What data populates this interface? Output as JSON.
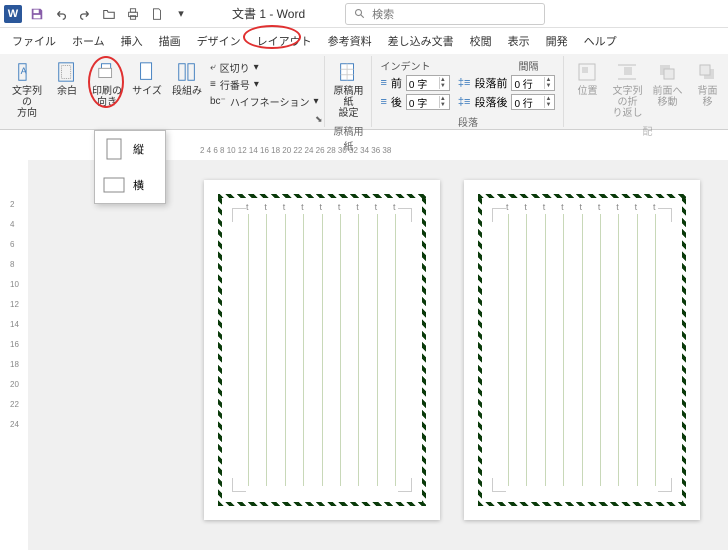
{
  "titlebar": {
    "doc_title": "文書 1 - Word",
    "search_placeholder": "検索"
  },
  "menu": {
    "file": "ファイル",
    "home": "ホーム",
    "insert": "挿入",
    "draw": "描画",
    "design": "デザイン",
    "layout": "レイアウト",
    "references": "参考資料",
    "mailings": "差し込み文書",
    "review": "校閲",
    "view": "表示",
    "developer": "開発",
    "help": "ヘルプ"
  },
  "ribbon": {
    "text_direction": "文字列の\n方向",
    "margins": "余白",
    "orientation": "印刷の\n向き",
    "size": "サイズ",
    "columns": "段組み",
    "breaks": "区切り",
    "line_numbers": "行番号",
    "hyphenation": "ハイフネーション",
    "page_setup_label": "",
    "genkoyoshi": "原稿用紙\n設定",
    "genkoyoshi_label": "原稿用紙",
    "indent_label": "インデント",
    "spacing_label": "間隔",
    "indent_left": "前",
    "indent_right": "後",
    "indent_left_val": "0 字",
    "indent_right_val": "0 字",
    "space_before": "段落前",
    "space_after": "段落後",
    "space_before_val": "0 行",
    "space_after_val": "0 行",
    "paragraph_label": "段落",
    "position": "位置",
    "wrap": "文字列の折\nり返し",
    "bring_forward": "前面へ\n移動",
    "send_backward": "背面\n移",
    "arrange_label": "配"
  },
  "orientation_dropdown": {
    "portrait": "縦",
    "landscape": "横"
  },
  "ruler_h": "2 4 6 8 10 12 14 16 18 20 22 24 26 28 30 32 34 36 38",
  "ruler_v": [
    "2",
    "4",
    "6",
    "8",
    "10",
    "12",
    "14",
    "16",
    "18",
    "20",
    "22",
    "24"
  ]
}
